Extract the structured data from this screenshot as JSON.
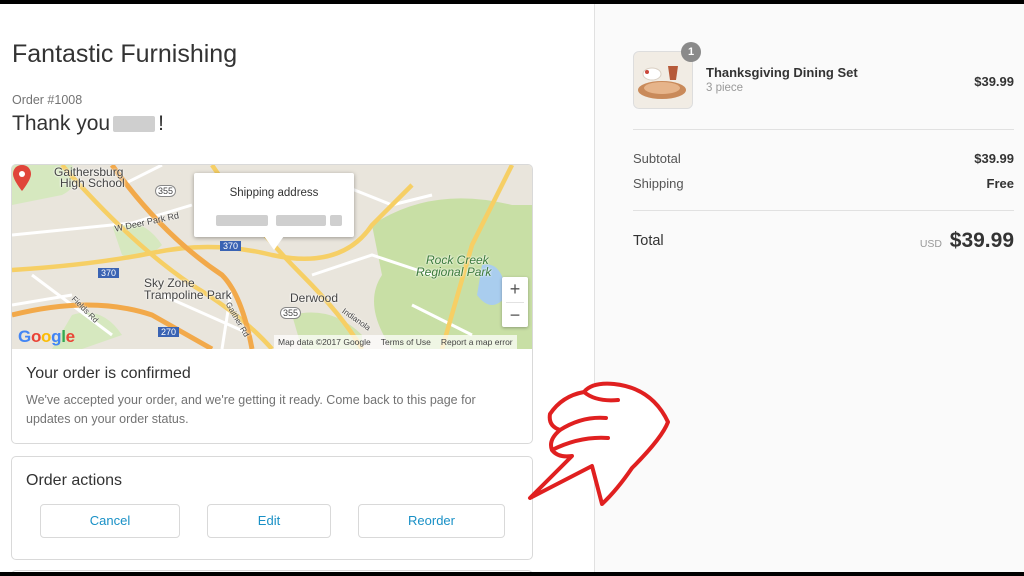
{
  "shop": {
    "title": "Fantastic Furnishing"
  },
  "order": {
    "number": "Order #1008",
    "thanks_prefix": "Thank you",
    "thanks_suffix": "!"
  },
  "map": {
    "popup_title": "Shipping address",
    "labels": {
      "gaithersburg": "Gaithersburg",
      "high_school": "High School",
      "sky_zone": "Sky Zone",
      "trampoline": "Trampoline Park",
      "derwood": "Derwood",
      "rock_creek": "Rock Creek",
      "regional_park": "Regional Park",
      "w_deer_park": "W Deer Park Rd",
      "fields_rd": "Fields Rd",
      "indianola": "Indianola",
      "gaither": "Gaither Rd",
      "hwy_355_a": "355",
      "hwy_355_b": "355",
      "hwy_370_a": "370",
      "hwy_370_b": "370",
      "hwy_270": "270"
    },
    "zoom_in": "+",
    "zoom_out": "−",
    "google_logo": [
      "G",
      "o",
      "o",
      "g",
      "l",
      "e"
    ],
    "attribution": {
      "data": "Map data ©2017 Google",
      "terms": "Terms of Use",
      "report": "Report a map error"
    }
  },
  "confirmation": {
    "title": "Your order is confirmed",
    "text": "We've accepted your order, and we're getting it ready. Come back to this page for updates on your order status."
  },
  "actions": {
    "title": "Order actions",
    "cancel": "Cancel",
    "edit": "Edit",
    "reorder": "Reorder"
  },
  "summary": {
    "product": {
      "name": "Thanksgiving Dining Set",
      "variant": "3 piece",
      "price": "$39.99",
      "quantity": "1"
    },
    "subtotal_label": "Subtotal",
    "subtotal_value": "$39.99",
    "shipping_label": "Shipping",
    "shipping_value": "Free",
    "total_label": "Total",
    "currency": "USD",
    "total_value": "$39.99"
  },
  "colors": {
    "accent": "#1990c6",
    "pin": "#e0453a",
    "annotation": "#e02020",
    "park": "#c8dfa5"
  },
  "icons": [
    "map-pin-icon",
    "pointing-hand-icon",
    "highway-shield-icon"
  ]
}
